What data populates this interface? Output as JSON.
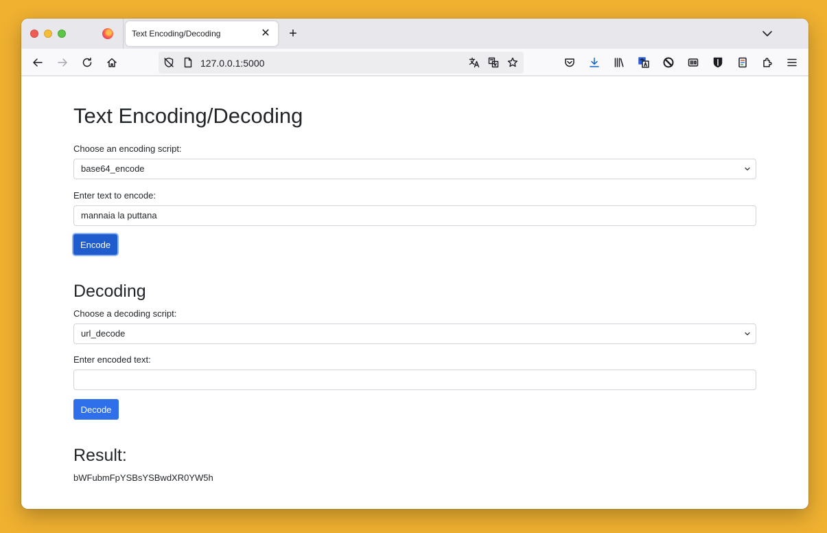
{
  "browser": {
    "tab_title": "Text Encoding/Decoding",
    "tab_close": "✕",
    "new_tab": "+",
    "url": "127.0.0.1:5000"
  },
  "page": {
    "title": "Text Encoding/Decoding",
    "encoding": {
      "script_label": "Choose an encoding script:",
      "script_selected": "base64_encode",
      "text_label": "Enter text to encode:",
      "text_value": "mannaia la puttana",
      "button_label": "Encode"
    },
    "decoding": {
      "heading": "Decoding",
      "script_label": "Choose a decoding script:",
      "script_selected": "url_decode",
      "text_label": "Enter encoded text:",
      "text_value": "",
      "button_label": "Decode"
    },
    "result": {
      "heading": "Result:",
      "value": "bWFubmFpYSBsYSBwdXR0YW5h"
    }
  },
  "colors": {
    "desktop_bg": "#f0b131",
    "primary_button": "#2f6fe9",
    "focused_button": "#1f5ccd",
    "text": "#212529"
  },
  "icons": [
    "firefox-icon",
    "back-icon",
    "forward-icon",
    "reload-icon",
    "home-icon",
    "tracking-shield-icon",
    "page-icon",
    "translate-icon",
    "translate-page-icon",
    "bookmark-star-icon",
    "pocket-icon",
    "downloads-icon",
    "library-icon",
    "translate-extension-icon",
    "block-extension-icon",
    "reader-extension-icon",
    "bitwarden-icon",
    "pdf-extension-icon",
    "extensions-icon",
    "menu-icon"
  ]
}
